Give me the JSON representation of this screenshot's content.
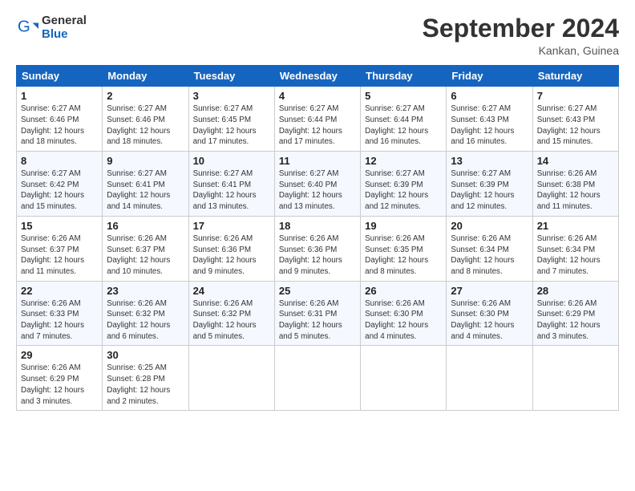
{
  "logo": {
    "general": "General",
    "blue": "Blue"
  },
  "title": "September 2024",
  "location": "Kankan, Guinea",
  "days_of_week": [
    "Sunday",
    "Monday",
    "Tuesday",
    "Wednesday",
    "Thursday",
    "Friday",
    "Saturday"
  ],
  "weeks": [
    [
      {
        "day": "1",
        "sunrise": "6:27 AM",
        "sunset": "6:46 PM",
        "daylight": "12 hours and 18 minutes."
      },
      {
        "day": "2",
        "sunrise": "6:27 AM",
        "sunset": "6:46 PM",
        "daylight": "12 hours and 18 minutes."
      },
      {
        "day": "3",
        "sunrise": "6:27 AM",
        "sunset": "6:45 PM",
        "daylight": "12 hours and 17 minutes."
      },
      {
        "day": "4",
        "sunrise": "6:27 AM",
        "sunset": "6:44 PM",
        "daylight": "12 hours and 17 minutes."
      },
      {
        "day": "5",
        "sunrise": "6:27 AM",
        "sunset": "6:44 PM",
        "daylight": "12 hours and 16 minutes."
      },
      {
        "day": "6",
        "sunrise": "6:27 AM",
        "sunset": "6:43 PM",
        "daylight": "12 hours and 16 minutes."
      },
      {
        "day": "7",
        "sunrise": "6:27 AM",
        "sunset": "6:43 PM",
        "daylight": "12 hours and 15 minutes."
      }
    ],
    [
      {
        "day": "8",
        "sunrise": "6:27 AM",
        "sunset": "6:42 PM",
        "daylight": "12 hours and 15 minutes."
      },
      {
        "day": "9",
        "sunrise": "6:27 AM",
        "sunset": "6:41 PM",
        "daylight": "12 hours and 14 minutes."
      },
      {
        "day": "10",
        "sunrise": "6:27 AM",
        "sunset": "6:41 PM",
        "daylight": "12 hours and 13 minutes."
      },
      {
        "day": "11",
        "sunrise": "6:27 AM",
        "sunset": "6:40 PM",
        "daylight": "12 hours and 13 minutes."
      },
      {
        "day": "12",
        "sunrise": "6:27 AM",
        "sunset": "6:39 PM",
        "daylight": "12 hours and 12 minutes."
      },
      {
        "day": "13",
        "sunrise": "6:27 AM",
        "sunset": "6:39 PM",
        "daylight": "12 hours and 12 minutes."
      },
      {
        "day": "14",
        "sunrise": "6:26 AM",
        "sunset": "6:38 PM",
        "daylight": "12 hours and 11 minutes."
      }
    ],
    [
      {
        "day": "15",
        "sunrise": "6:26 AM",
        "sunset": "6:37 PM",
        "daylight": "12 hours and 11 minutes."
      },
      {
        "day": "16",
        "sunrise": "6:26 AM",
        "sunset": "6:37 PM",
        "daylight": "12 hours and 10 minutes."
      },
      {
        "day": "17",
        "sunrise": "6:26 AM",
        "sunset": "6:36 PM",
        "daylight": "12 hours and 9 minutes."
      },
      {
        "day": "18",
        "sunrise": "6:26 AM",
        "sunset": "6:36 PM",
        "daylight": "12 hours and 9 minutes."
      },
      {
        "day": "19",
        "sunrise": "6:26 AM",
        "sunset": "6:35 PM",
        "daylight": "12 hours and 8 minutes."
      },
      {
        "day": "20",
        "sunrise": "6:26 AM",
        "sunset": "6:34 PM",
        "daylight": "12 hours and 8 minutes."
      },
      {
        "day": "21",
        "sunrise": "6:26 AM",
        "sunset": "6:34 PM",
        "daylight": "12 hours and 7 minutes."
      }
    ],
    [
      {
        "day": "22",
        "sunrise": "6:26 AM",
        "sunset": "6:33 PM",
        "daylight": "12 hours and 7 minutes."
      },
      {
        "day": "23",
        "sunrise": "6:26 AM",
        "sunset": "6:32 PM",
        "daylight": "12 hours and 6 minutes."
      },
      {
        "day": "24",
        "sunrise": "6:26 AM",
        "sunset": "6:32 PM",
        "daylight": "12 hours and 5 minutes."
      },
      {
        "day": "25",
        "sunrise": "6:26 AM",
        "sunset": "6:31 PM",
        "daylight": "12 hours and 5 minutes."
      },
      {
        "day": "26",
        "sunrise": "6:26 AM",
        "sunset": "6:30 PM",
        "daylight": "12 hours and 4 minutes."
      },
      {
        "day": "27",
        "sunrise": "6:26 AM",
        "sunset": "6:30 PM",
        "daylight": "12 hours and 4 minutes."
      },
      {
        "day": "28",
        "sunrise": "6:26 AM",
        "sunset": "6:29 PM",
        "daylight": "12 hours and 3 minutes."
      }
    ],
    [
      {
        "day": "29",
        "sunrise": "6:26 AM",
        "sunset": "6:29 PM",
        "daylight": "12 hours and 3 minutes."
      },
      {
        "day": "30",
        "sunrise": "6:25 AM",
        "sunset": "6:28 PM",
        "daylight": "12 hours and 2 minutes."
      },
      null,
      null,
      null,
      null,
      null
    ]
  ]
}
